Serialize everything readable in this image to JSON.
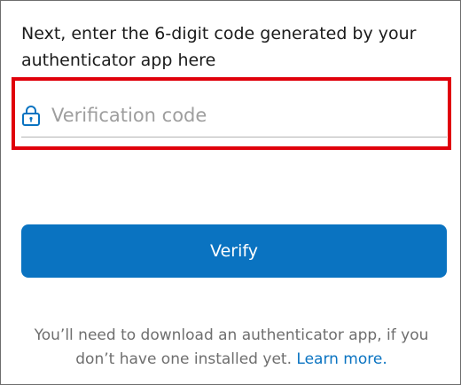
{
  "instruction": "Next, enter the 6-digit code generated by your authenticator app here",
  "verification_field": {
    "placeholder": "Verification code",
    "value": "",
    "icon": "lock-icon"
  },
  "verify_button": {
    "label": "Verify"
  },
  "help": {
    "text": "You’ll need to download an authenticator app, if you don’t have one installed yet.",
    "link_label": "Learn more."
  },
  "colors": {
    "highlight": "#e0000b",
    "button": "#0a73c1",
    "link": "#0a73c1",
    "icon": "#0a73c1"
  }
}
